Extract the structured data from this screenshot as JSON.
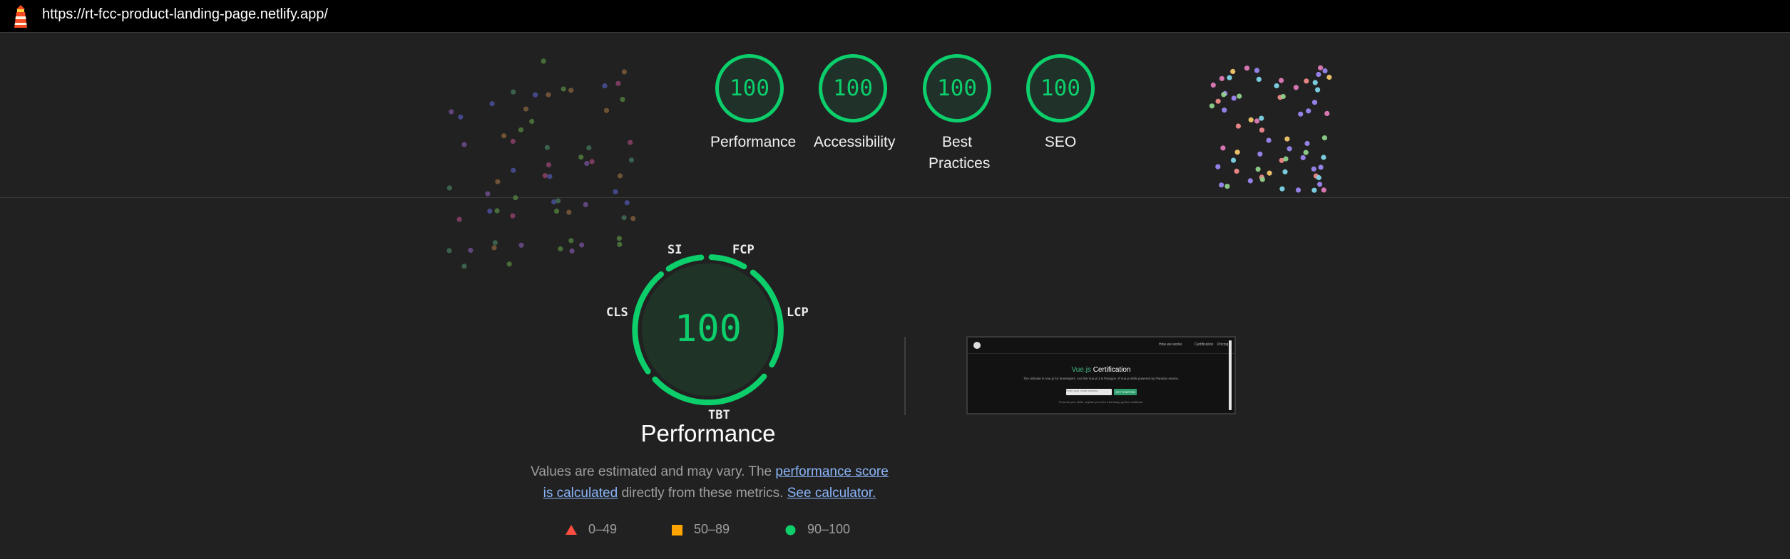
{
  "browser": {
    "url": "https://rt-fcc-product-landing-page.netlify.app/"
  },
  "categories": [
    {
      "score": "100",
      "label": "Performance"
    },
    {
      "score": "100",
      "label": "Accessibility"
    },
    {
      "score": "100",
      "label": "Best Practices"
    },
    {
      "score": "100",
      "label": "SEO"
    }
  ],
  "performance": {
    "score": "100",
    "title": "Performance",
    "metrics": {
      "si": "SI",
      "fcp": "FCP",
      "lcp": "LCP",
      "tbt": "TBT",
      "cls": "CLS"
    },
    "description": {
      "text1": "Values are estimated and may vary. The ",
      "link1": "performance score is calculated",
      "text2": " directly from these metrics. ",
      "link2": "See calculator."
    }
  },
  "legend": {
    "fail": "0–49",
    "average": "50–89",
    "pass": "90–100"
  },
  "screenshot_preview": {
    "title_accent": "Vue.js",
    "title_rest": " Certification",
    "subtitle": "The ultimate in Vue.js for developers. Ace the Vue.js 3 & Paragon of Vue.js skills powered by Paradox exams.",
    "nav": [
      "How we works",
      "Certification",
      "Pricing"
    ],
    "input_placeholder": "Enter your email address",
    "button": "GET STARTED",
    "footer": "Promote your skills, register your free trial today, get the certificate."
  },
  "colors": {
    "pass": "#0cce6b",
    "average": "#ffa400",
    "fail": "#ff4e42",
    "background": "#212121"
  }
}
